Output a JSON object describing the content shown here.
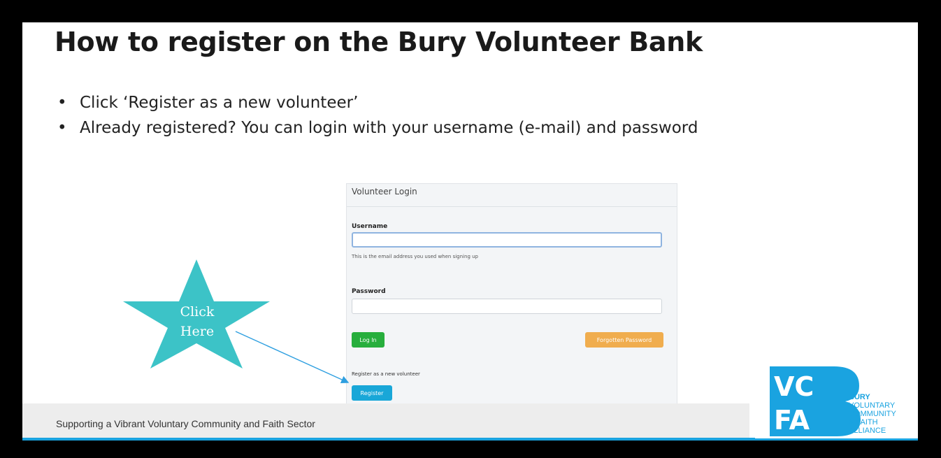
{
  "slide": {
    "title": "How to register on the Bury Volunteer Bank",
    "bullets": [
      "Click ‘Register as a new volunteer’",
      "Already registered? You can login with your username (e-mail) and password"
    ]
  },
  "login_panel": {
    "title": "Volunteer Login",
    "username_label": "Username",
    "username_help": "This is the email address you used when signing up",
    "password_label": "Password",
    "login_button": "Log In",
    "forgot_button": "Forgotten Password",
    "register_prompt": "Register as a new volunteer",
    "register_button": "Register"
  },
  "callout": {
    "line1": "Click",
    "line2": "Here",
    "star_color": "#3cc3c7",
    "arrow_color": "#2e9fe0"
  },
  "footer": {
    "tagline": "Supporting a Vibrant Voluntary Community and Faith Sector"
  },
  "logo": {
    "letters_top": "VC",
    "letters_bottom": "FA",
    "lines": [
      "BURY",
      "VOLUNTARY",
      "COMMUNITY",
      "& FAITH",
      "ALLIANCE"
    ],
    "color": "#1aa3e0"
  }
}
